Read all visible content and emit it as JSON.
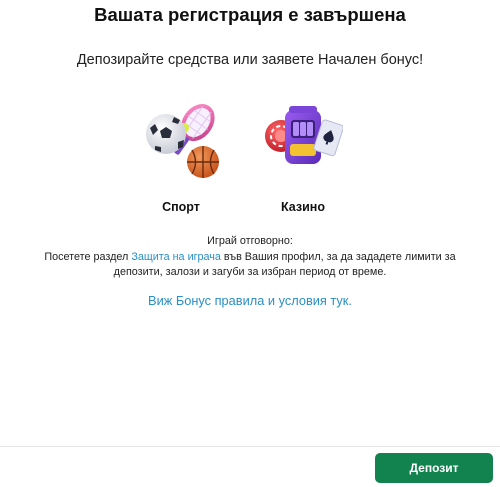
{
  "header": {
    "title": "Вашата регистрация е завършена",
    "subtitle": "Депозирайте средства или заявете Начален бонус!"
  },
  "options": [
    {
      "label": "Спорт",
      "icon": "sports-balls-icon"
    },
    {
      "label": "Казино",
      "icon": "slot-machine-cards-icon"
    }
  ],
  "responsible_gaming": {
    "title": "Играй отговорно:",
    "text_before_link": "Посетете раздел ",
    "link_text": "Защита на играча",
    "text_after_link": " във Вашия профил, за да зададете лимити за депозити, залози и загуби за избран период от време."
  },
  "bonus_link": "Виж Бонус правила и условия тук.",
  "footer": {
    "deposit_label": "Депозит"
  },
  "colors": {
    "accent_green": "#12834f",
    "link_blue": "#2a8fc4"
  }
}
